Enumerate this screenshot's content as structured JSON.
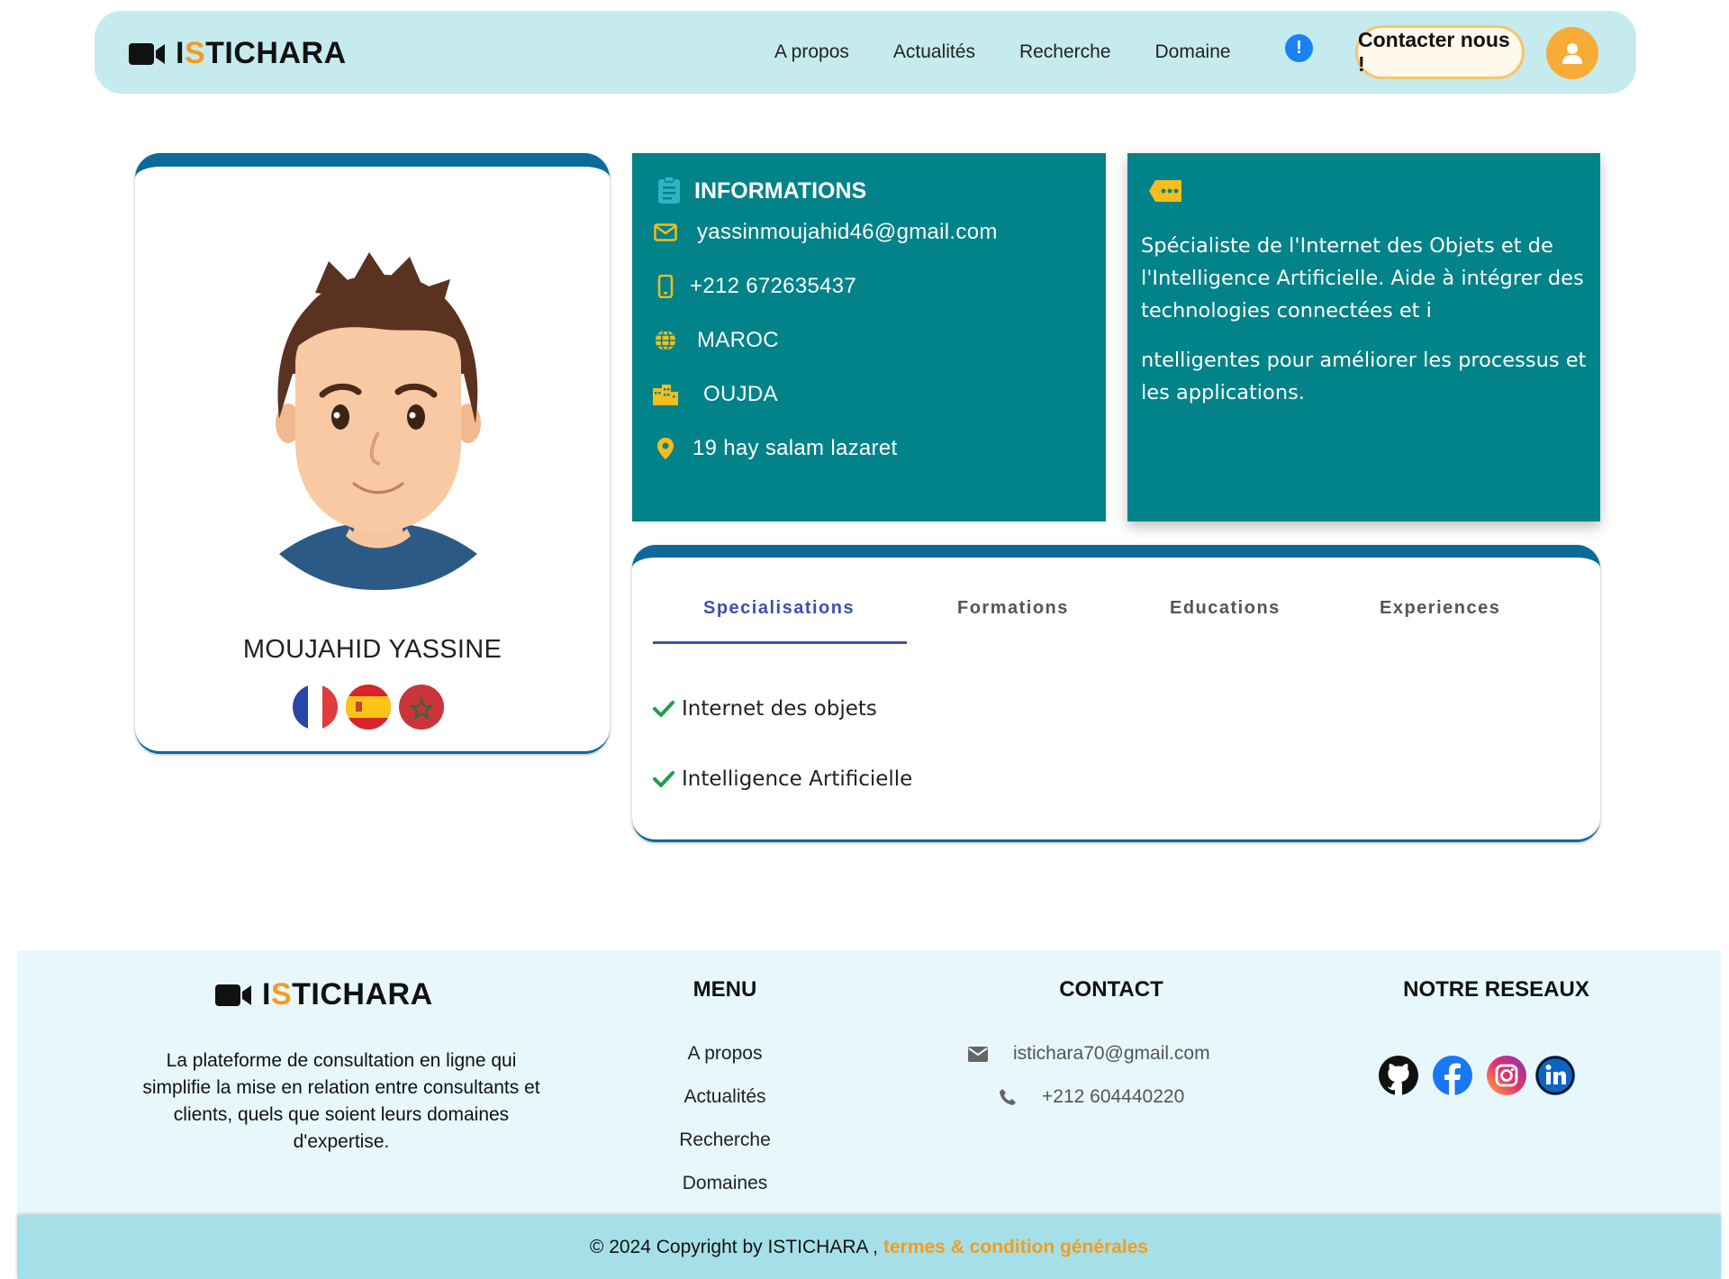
{
  "brand": {
    "prefix_i": "I",
    "prefix_s": "S",
    "rest": "TICHARA",
    "accent_color": "#f39c1f"
  },
  "nav": {
    "links": [
      "A propos",
      "Actualités",
      "Recherche",
      "Domaine"
    ],
    "info_badge": "!",
    "contact_label": "Contacter nous !"
  },
  "profile": {
    "name": "MOUJAHID YASSINE",
    "languages": [
      "french-flag",
      "spanish-flag",
      "moroccan-flag"
    ]
  },
  "informations": {
    "title": "INFORMATIONS",
    "email": "yassinmoujahid46@gmail.com",
    "phone": "+212 672635437",
    "country": "MAROC",
    "city": "OUJDA",
    "address": "19 hay salam lazaret"
  },
  "bio": {
    "paragraph1": "Spécialiste de l'Internet des Objets et de l'Intelligence Artificielle. Aide à intégrer des technologies connectées et i",
    "paragraph2": "ntelligentes pour améliorer les processus et les applications."
  },
  "tabs": {
    "items": [
      "Specialisations",
      "Formations",
      "Educations",
      "Experiences"
    ],
    "active": "Specialisations",
    "specialisations": [
      "Internet des objets",
      "Intelligence Artificielle"
    ]
  },
  "footer": {
    "description": "La plateforme de consultation en ligne qui simplifie la mise en relation entre consultants et clients, quels que soient leurs domaines d'expertise.",
    "menu_title": "MENU",
    "menu": [
      "A propos",
      "Actualités",
      "Recherche",
      "Domaines"
    ],
    "contact_title": "CONTACT",
    "contact_email": "istichara70@gmail.com",
    "contact_phone": "+212 604440220",
    "social_title": "NOTRE RESEAUX",
    "socials": [
      "github-icon",
      "facebook-icon",
      "instagram-icon",
      "linkedin-icon"
    ]
  },
  "copyright": {
    "text": "© 2024 Copyright by ISTICHARA ,",
    "terms": "termes & condition générales"
  },
  "colors": {
    "teal": "#028289",
    "dark_blue": "#0b6a9a",
    "nav_bg": "#c6ebee",
    "orange": "#f39c1f",
    "tab_active": "#3c4fb4"
  }
}
